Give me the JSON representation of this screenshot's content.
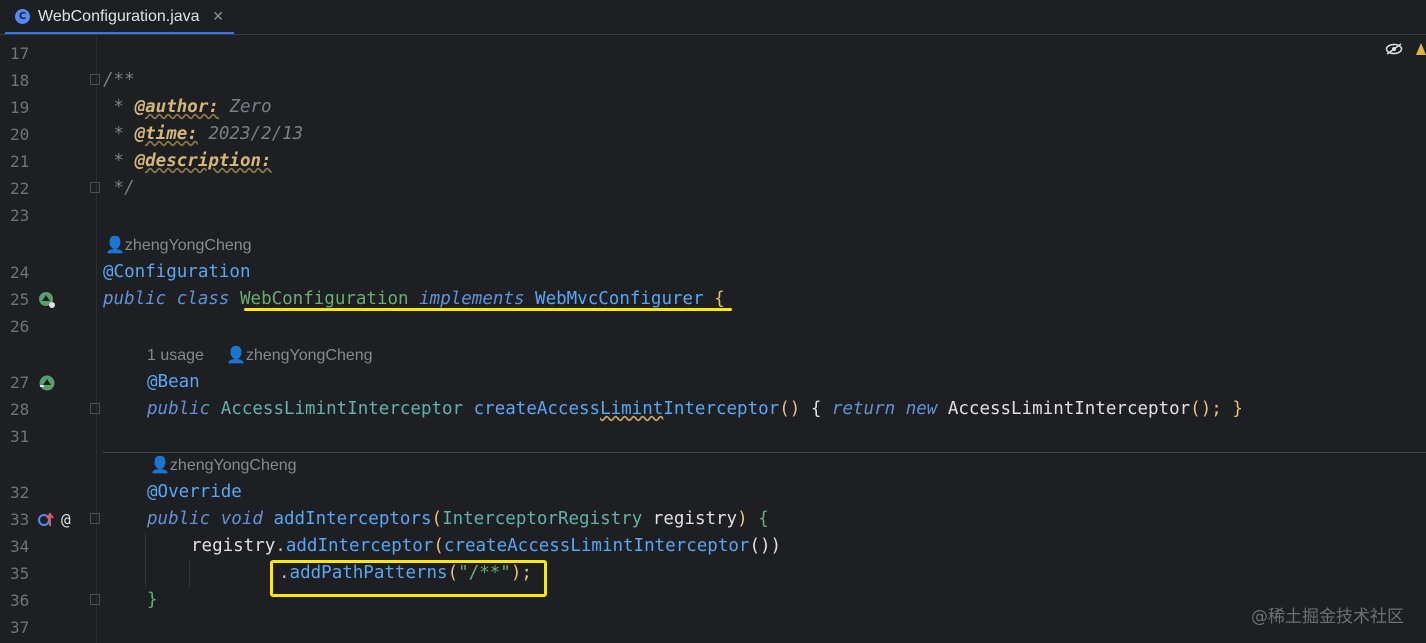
{
  "tab": {
    "icon": "class-c-icon",
    "icon_letter": "C",
    "label": "WebConfiguration.java",
    "close": "✕"
  },
  "colors": {
    "background": "#1e1f22",
    "highlight": "#ffe800",
    "keyword": "#5e93d8",
    "annotation": "#56a8f5",
    "string": "#6aab73"
  },
  "editor": {
    "lines": [
      {
        "num": "17"
      },
      {
        "num": "18",
        "text": "/**"
      },
      {
        "num": "19",
        "prefix": " * ",
        "tag": "@author:",
        "value": " Zero"
      },
      {
        "num": "20",
        "prefix": " * ",
        "tag": "@time:",
        "value": " 2023/2/13"
      },
      {
        "num": "21",
        "prefix": " * ",
        "tag": "@description:"
      },
      {
        "num": "22",
        "text": " */"
      },
      {
        "num": "23"
      },
      {
        "num": "24",
        "annotation": "@Configuration"
      },
      {
        "num": "25",
        "kw1": "public",
        "kw2": "class",
        "class_name": "WebConfiguration",
        "kw3": "implements",
        "interface": "WebMvcConfigurer",
        "brace": "{"
      },
      {
        "num": "26"
      },
      {
        "num": "27",
        "annotation": "@Bean"
      },
      {
        "num": "28",
        "kw1": "public",
        "type": "AccessLimintInterceptor",
        "method_a": "createAccess",
        "method_b": "Limint",
        "method_c": "Interceptor",
        "parens": "()",
        "brace_open": "{",
        "kw_return": "return",
        "kw_new": "new",
        "ctor": "AccessLimintInterceptor",
        "tail": "(); }"
      },
      {
        "num": "31"
      },
      {
        "num": "32",
        "annotation": "@Override"
      },
      {
        "num": "33",
        "kw1": "public",
        "kw2": "void",
        "method": "addInterceptors",
        "paren_open": "(",
        "param_type": "InterceptorRegistry",
        "param": "registry",
        "paren_close": ")",
        "brace": "{"
      },
      {
        "num": "34",
        "obj": "registry",
        "dot": ".",
        "call": "addInterceptor",
        "paren_open": "(",
        "arg": "createAccessLimintInterceptor",
        "args_close": "())"
      },
      {
        "num": "35",
        "dot": ".",
        "call": "addPathPatterns",
        "paren_open": "(",
        "string": "\"/**\"",
        "tail": ");"
      },
      {
        "num": "36",
        "brace": "}"
      },
      {
        "num": "37"
      }
    ],
    "hints": {
      "author_24": "zhengYongCheng",
      "usage_27": "1 usage",
      "author_27": "zhengYongCheng",
      "author_32": "zhengYongCheng"
    },
    "gutter_icons": {
      "line25": "implements-bean-icon",
      "line27": "bean-method-icon",
      "line33_a": "override-method-icon",
      "line33_b": "@"
    }
  },
  "watermark": "@稀土掘金技术社区"
}
